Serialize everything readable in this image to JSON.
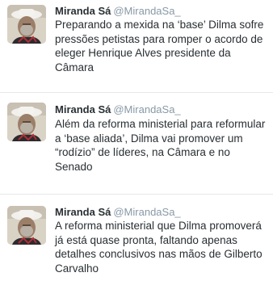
{
  "tweets": [
    {
      "name": "Miranda Sá",
      "handle": "@MirandaSa_",
      "text": "Preparando a mexida na ‘base’ Dilma sofre pressões petistas para romper o acordo de eleger Henrique Alves presidente da Câmara"
    },
    {
      "name": "Miranda Sá",
      "handle": "@MirandaSa_",
      "text": "Além da reforma ministerial para reformular a ‘base aliada’, Dilma vai promover um “rodízio” de líderes, na Câmara e no Senado"
    },
    {
      "name": "Miranda Sá",
      "handle": "@MirandaSa_",
      "text": "A reforma ministerial que Dilma promoverá já está quase pronta, faltando apenas detalhes conclusivos nas mãos de Gilberto Carvalho"
    }
  ],
  "icons": {
    "avatar": "profile-photo-avatar"
  }
}
